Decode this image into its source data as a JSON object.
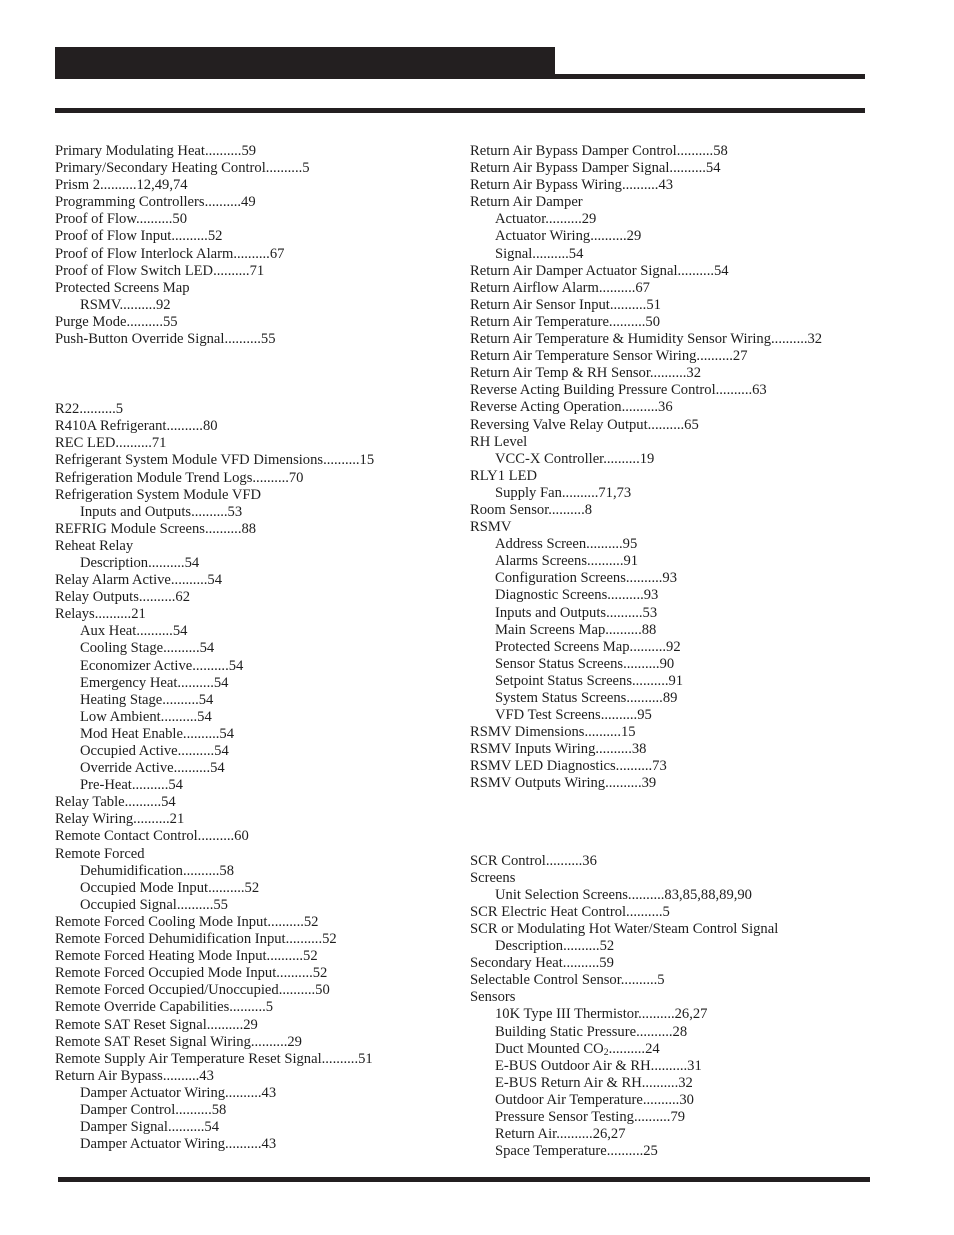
{
  "header": {
    "title": "",
    "bar_color": "#231f20"
  },
  "footer": {
    "rule_color": "#231f20"
  },
  "columns": {
    "left": [
      {
        "label": "Primary Modulating Heat..........59",
        "level": 0
      },
      {
        "label": "Primary/Secondary Heating Control..........5",
        "level": 0
      },
      {
        "label": "Prism 2..........12,49,74",
        "level": 0
      },
      {
        "label": "Programming Controllers..........49",
        "level": 0
      },
      {
        "label": "Proof of Flow..........50",
        "level": 0
      },
      {
        "label": "Proof of Flow Input..........52",
        "level": 0
      },
      {
        "label": "Proof of Flow Interlock Alarm..........67",
        "level": 0
      },
      {
        "label": "Proof of Flow Switch LED..........71",
        "level": 0
      },
      {
        "label": "Protected Screens Map",
        "level": 0
      },
      {
        "label": "RSMV..........92",
        "level": 1
      },
      {
        "label": "Purge Mode..........55",
        "level": 0
      },
      {
        "label": "Push-Button Override Signal..........55",
        "level": 0
      },
      {
        "label": "",
        "level": 0,
        "gap": true
      },
      {
        "label": "R22..........5",
        "level": 0
      },
      {
        "label": "R410A Refrigerant..........80",
        "level": 0
      },
      {
        "label": "REC LED..........71",
        "level": 0
      },
      {
        "label": "Refrigerant System Module VFD Dimensions..........15",
        "level": 0
      },
      {
        "label": "Refrigeration Module Trend Logs..........70",
        "level": 0
      },
      {
        "label": "Refrigeration System Module VFD",
        "level": 0
      },
      {
        "label": "Inputs and Outputs..........53",
        "level": 1
      },
      {
        "label": "REFRIG Module Screens..........88",
        "level": 0
      },
      {
        "label": "Reheat Relay",
        "level": 0
      },
      {
        "label": "Description..........54",
        "level": 1
      },
      {
        "label": "Relay Alarm Active..........54",
        "level": 0
      },
      {
        "label": "Relay Outputs..........62",
        "level": 0
      },
      {
        "label": "Relays..........21",
        "level": 0
      },
      {
        "label": "Aux Heat..........54",
        "level": 1
      },
      {
        "label": "Cooling Stage..........54",
        "level": 1
      },
      {
        "label": "Economizer Active..........54",
        "level": 1
      },
      {
        "label": "Emergency Heat..........54",
        "level": 1
      },
      {
        "label": "Heating Stage..........54",
        "level": 1
      },
      {
        "label": "Low Ambient..........54",
        "level": 1
      },
      {
        "label": "Mod Heat Enable..........54",
        "level": 1
      },
      {
        "label": "Occupied Active..........54",
        "level": 1
      },
      {
        "label": "Override Active..........54",
        "level": 1
      },
      {
        "label": "Pre-Heat..........54",
        "level": 1
      },
      {
        "label": "Relay Table..........54",
        "level": 0
      },
      {
        "label": "Relay Wiring..........21",
        "level": 0
      },
      {
        "label": "Remote Contact Control..........60",
        "level": 0
      },
      {
        "label": "Remote Forced",
        "level": 0
      },
      {
        "label": "Dehumidification..........58",
        "level": 1
      },
      {
        "label": "Occupied Mode Input..........52",
        "level": 1
      },
      {
        "label": "Occupied Signal..........55",
        "level": 1
      },
      {
        "label": "Remote Forced Cooling Mode Input..........52",
        "level": 0
      },
      {
        "label": "Remote Forced Dehumidification Input..........52",
        "level": 0
      },
      {
        "label": "Remote Forced Heating Mode Input..........52",
        "level": 0
      },
      {
        "label": "Remote Forced Occupied Mode Input..........52",
        "level": 0
      },
      {
        "label": "Remote Forced Occupied/Unoccupied..........50",
        "level": 0
      },
      {
        "label": "Remote Override Capabilities..........5",
        "level": 0
      },
      {
        "label": "Remote SAT Reset Signal..........29",
        "level": 0
      },
      {
        "label": "Remote SAT Reset Signal Wiring..........29",
        "level": 0
      },
      {
        "label": "Remote Supply Air Temperature Reset Signal..........51",
        "level": 0
      },
      {
        "label": "Return Air Bypass..........43",
        "level": 0
      },
      {
        "label": "Damper Actuator Wiring..........43",
        "level": 1
      },
      {
        "label": "Damper Control..........58",
        "level": 1
      },
      {
        "label": "Damper Signal..........54",
        "level": 1
      },
      {
        "label": "Damper Actuator Wiring..........43",
        "level": 1
      }
    ],
    "right": [
      {
        "label": "Return Air Bypass Damper Control..........58",
        "level": 0
      },
      {
        "label": "Return Air Bypass Damper Signal..........54",
        "level": 0
      },
      {
        "label": "Return Air Bypass Wiring..........43",
        "level": 0
      },
      {
        "label": "Return Air Damper",
        "level": 0
      },
      {
        "label": "Actuator..........29",
        "level": 1
      },
      {
        "label": "Actuator Wiring..........29",
        "level": 1
      },
      {
        "label": "Signal..........54",
        "level": 1
      },
      {
        "label": "Return Air Damper Actuator Signal..........54",
        "level": 0
      },
      {
        "label": "Return Airflow Alarm..........67",
        "level": 0
      },
      {
        "label": "Return Air Sensor Input..........51",
        "level": 0
      },
      {
        "label": "Return Air Temperature..........50",
        "level": 0
      },
      {
        "label": "Return Air Temperature & Humidity Sensor Wiring..........32",
        "level": 0
      },
      {
        "label": "Return Air Temperature Sensor Wiring..........27",
        "level": 0
      },
      {
        "label": "Return Air Temp & RH Sensor..........32",
        "level": 0
      },
      {
        "label": "Reverse Acting Building Pressure Control..........63",
        "level": 0
      },
      {
        "label": "Reverse Acting Operation..........36",
        "level": 0
      },
      {
        "label": "Reversing Valve Relay Output..........65",
        "level": 0
      },
      {
        "label": "RH Level",
        "level": 0
      },
      {
        "label": "VCC-X Controller..........19",
        "level": 1
      },
      {
        "label": "RLY1 LED",
        "level": 0
      },
      {
        "label": "Supply Fan..........71,73",
        "level": 1
      },
      {
        "label": "Room Sensor..........8",
        "level": 0
      },
      {
        "label": "RSMV",
        "level": 0
      },
      {
        "label": "Address Screen..........95",
        "level": 1
      },
      {
        "label": "Alarms Screens..........91",
        "level": 1
      },
      {
        "label": "Configuration Screens..........93",
        "level": 1
      },
      {
        "label": "Diagnostic Screens..........93",
        "level": 1
      },
      {
        "label": "Inputs and Outputs..........53",
        "level": 1
      },
      {
        "label": "Main Screens Map..........88",
        "level": 1
      },
      {
        "label": "Protected Screens Map..........92",
        "level": 1
      },
      {
        "label": "Sensor Status Screens..........90",
        "level": 1
      },
      {
        "label": "Setpoint Status Screens..........91",
        "level": 1
      },
      {
        "label": "System Status Screens..........89",
        "level": 1
      },
      {
        "label": "VFD Test Screens..........95",
        "level": 1
      },
      {
        "label": "RSMV Dimensions..........15",
        "level": 0
      },
      {
        "label": "RSMV Inputs Wiring..........38",
        "level": 0
      },
      {
        "label": "RSMV LED Diagnostics..........73",
        "level": 0
      },
      {
        "label": "RSMV Outputs Wiring..........39",
        "level": 0
      },
      {
        "label": "",
        "level": 0,
        "gap": true
      },
      {
        "label": "SCR Control..........36",
        "level": 0
      },
      {
        "label": "Screens",
        "level": 0
      },
      {
        "label": "Unit Selection Screens..........83,85,88,89,90",
        "level": 1
      },
      {
        "label": "SCR Electric Heat Control..........5",
        "level": 0
      },
      {
        "label": "SCR or Modulating Hot Water/Steam Control Signal",
        "level": 0
      },
      {
        "label": "Description..........52",
        "level": 1
      },
      {
        "label": "Secondary Heat..........59",
        "level": 0
      },
      {
        "label": "Selectable Control Sensor..........5",
        "level": 0
      },
      {
        "label": "Sensors",
        "level": 0
      },
      {
        "label": "10K Type III Thermistor..........26,27",
        "level": 1
      },
      {
        "label": "Building Static Pressure..........28",
        "level": 1
      },
      {
        "label": "Duct Mounted CO@2@..........24",
        "level": 1,
        "subscript": true
      },
      {
        "label": "E-BUS Outdoor Air & RH..........31",
        "level": 1
      },
      {
        "label": "E-BUS Return Air & RH..........32",
        "level": 1
      },
      {
        "label": "Outdoor Air Temperature..........30",
        "level": 1
      },
      {
        "label": "Pressure Sensor Testing..........79",
        "level": 1
      },
      {
        "label": "Return Air..........26,27",
        "level": 1
      },
      {
        "label": "Space Temperature..........25",
        "level": 1
      }
    ]
  }
}
